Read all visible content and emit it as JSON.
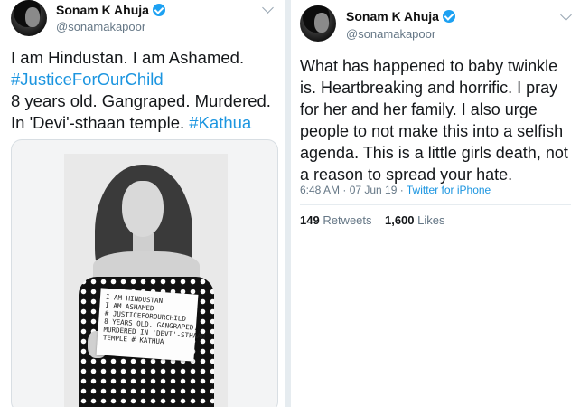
{
  "left_tweet": {
    "display_name": "Sonam K Ahuja",
    "handle": "@sonamakapoor",
    "lines": [
      "I am Hindustan. I am Ashamed.",
      "#JusticeForOurChild",
      "8 years old. Gangraped. Murdered.",
      "In 'Devi'-sthaan temple."
    ],
    "hashtag_inline": "#Kathua",
    "sign_lines": [
      "I AM HINDUSTAN",
      "I AM ASHAMED",
      "# JUSTICEFOROURCHILD",
      "8 YEARS OLD. GANGRAPED.",
      "MURDERED IN 'DEVI'-STHAAN",
      "TEMPLE # KATHUA"
    ]
  },
  "right_tweet": {
    "display_name": "Sonam K Ahuja",
    "handle": "@sonamakapoor",
    "lines": [
      "What has happened to baby twinkle",
      "is. Heartbreaking and horrific. I pray",
      "for her and her family. I also urge",
      "people to not make this into a selfish",
      "agenda. This is a little girls death, not",
      "a reason to spread your hate."
    ],
    "timestamp": "6:48 AM · 07 Jun 19 ·",
    "source": "Twitter for iPhone",
    "retweets_count": "149",
    "retweets_label": "Retweets",
    "likes_count": "1,600",
    "likes_label": "Likes"
  },
  "colors": {
    "link": "#1b95e0",
    "verified": "#1da1f2",
    "text": "#14171a",
    "muted": "#657786"
  },
  "icons": [
    "verified-badge-icon",
    "chevron-down-icon"
  ]
}
